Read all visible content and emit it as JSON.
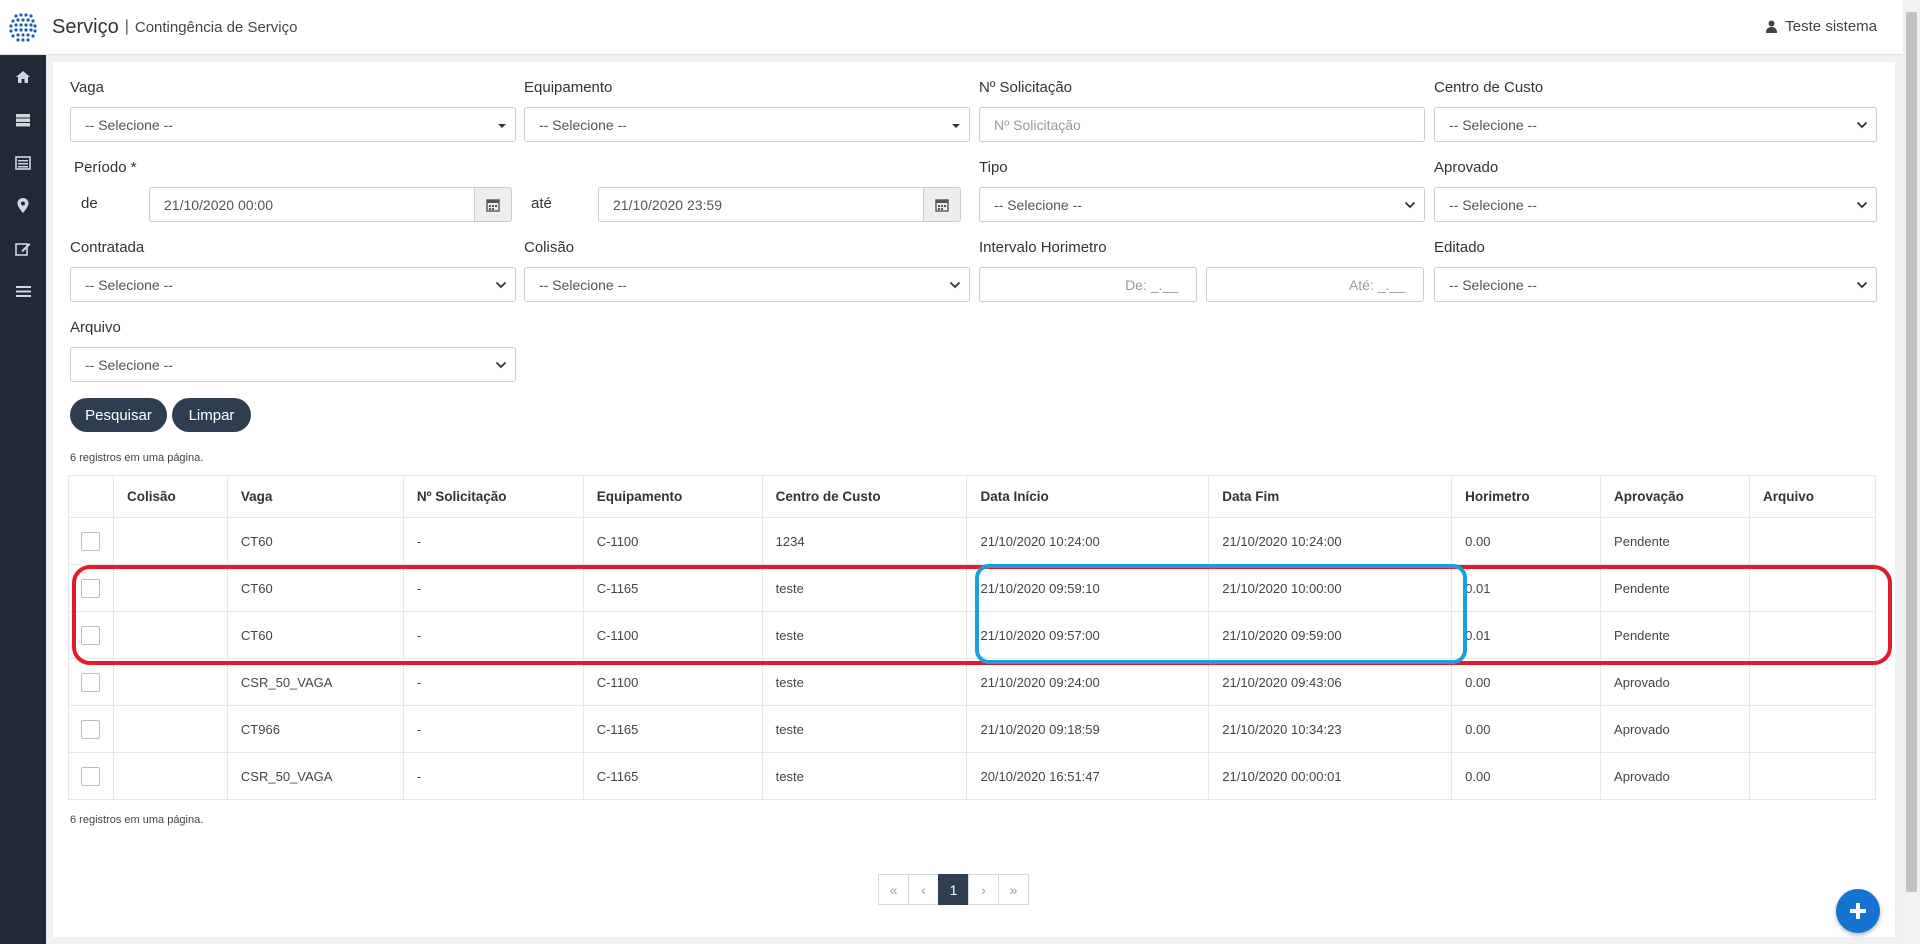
{
  "header": {
    "app_title": "Serviço",
    "separator": "|",
    "page_title": "Contingência de Serviço",
    "user_name": "Teste sistema"
  },
  "sidebar": {
    "items": [
      {
        "icon": "home-icon"
      },
      {
        "icon": "server-icon"
      },
      {
        "icon": "list-alt-icon"
      },
      {
        "icon": "map-marker-icon"
      },
      {
        "icon": "edit-icon"
      },
      {
        "icon": "menu-icon"
      }
    ]
  },
  "filters": {
    "vaga": {
      "label": "Vaga",
      "value": "-- Selecione --"
    },
    "equipamento": {
      "label": "Equipamento",
      "value": "-- Selecione --"
    },
    "solicitacao": {
      "label": "Nº Solicitação",
      "placeholder": "Nº Solicitação"
    },
    "centro_custo": {
      "label": "Centro de Custo",
      "value": "-- Selecione --"
    },
    "periodo": {
      "label": "Período *",
      "from_label": "de",
      "from_value": "21/10/2020 00:00",
      "to_label": "até",
      "to_value": "21/10/2020 23:59"
    },
    "tipo": {
      "label": "Tipo",
      "value": "-- Selecione --"
    },
    "aprovado": {
      "label": "Aprovado",
      "value": "-- Selecione --"
    },
    "contratada": {
      "label": "Contratada",
      "value": "-- Selecione --"
    },
    "colisao": {
      "label": "Colisão",
      "value": "-- Selecione --"
    },
    "horimetro": {
      "label": "Intervalo Horimetro",
      "from_placeholder": "De: _.__",
      "to_placeholder": "Até: _.__"
    },
    "editado": {
      "label": "Editado",
      "value": "-- Selecione --"
    },
    "arquivo": {
      "label": "Arquivo",
      "value": "-- Selecione --"
    }
  },
  "buttons": {
    "search": "Pesquisar",
    "clear": "Limpar"
  },
  "records_info_top": "6 registros em uma página.",
  "records_info_bottom": "6 registros em uma página.",
  "table": {
    "headers": [
      "Colisão",
      "Vaga",
      "Nº Solicitação",
      "Equipamento",
      "Centro de Custo",
      "Data Início",
      "Data Fim",
      "Horimetro",
      "Aprovação",
      "Arquivo"
    ],
    "rows": [
      {
        "colisao": "",
        "vaga": "CT60",
        "solicitacao": "-",
        "equipamento": "C-1100",
        "centro": "1234",
        "inicio": "21/10/2020 10:24:00",
        "fim": "21/10/2020 10:24:00",
        "horimetro": "0.00",
        "aprovacao": "Pendente",
        "arquivo": ""
      },
      {
        "colisao": "",
        "vaga": "CT60",
        "solicitacao": "-",
        "equipamento": "C-1165",
        "centro": "teste",
        "inicio": "21/10/2020 09:59:10",
        "fim": "21/10/2020 10:00:00",
        "horimetro": "0.01",
        "aprovacao": "Pendente",
        "arquivo": ""
      },
      {
        "colisao": "",
        "vaga": "CT60",
        "solicitacao": "-",
        "equipamento": "C-1100",
        "centro": "teste",
        "inicio": "21/10/2020 09:57:00",
        "fim": "21/10/2020 09:59:00",
        "horimetro": "0.01",
        "aprovacao": "Pendente",
        "arquivo": ""
      },
      {
        "colisao": "",
        "vaga": "CSR_50_VAGA",
        "solicitacao": "-",
        "equipamento": "C-1100",
        "centro": "teste",
        "inicio": "21/10/2020 09:24:00",
        "fim": "21/10/2020 09:43:06",
        "horimetro": "0.00",
        "aprovacao": "Aprovado",
        "arquivo": ""
      },
      {
        "colisao": "",
        "vaga": "CT966",
        "solicitacao": "-",
        "equipamento": "C-1165",
        "centro": "teste",
        "inicio": "21/10/2020 09:18:59",
        "fim": "21/10/2020 10:34:23",
        "horimetro": "0.00",
        "aprovacao": "Aprovado",
        "arquivo": ""
      },
      {
        "colisao": "",
        "vaga": "CSR_50_VAGA",
        "solicitacao": "-",
        "equipamento": "C-1165",
        "centro": "teste",
        "inicio": "20/10/2020 16:51:47",
        "fim": "21/10/2020 00:00:01",
        "horimetro": "0.00",
        "aprovacao": "Aprovado",
        "arquivo": ""
      }
    ]
  },
  "pagination": {
    "first": "«",
    "prev": "‹",
    "current": "1",
    "next": "›",
    "last": "»"
  },
  "colors": {
    "red_highlight": "#e21b2a",
    "blue_highlight": "#1b9ee0",
    "button": "#2f3e4f",
    "fab": "#1573d1"
  }
}
